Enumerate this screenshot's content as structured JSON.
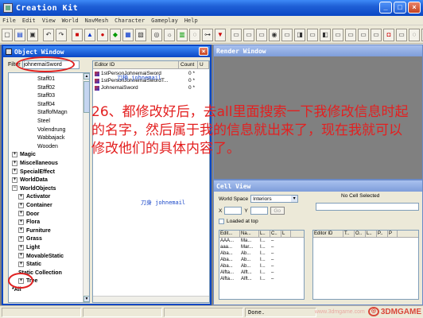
{
  "window": {
    "title": "Creation Kit"
  },
  "menu": [
    "File",
    "Edit",
    "View",
    "World",
    "NavMesh",
    "Character",
    "Gameplay",
    "Help"
  ],
  "object_window": {
    "title": "Object Window",
    "filter_label": "Filter",
    "filter_value": "johnemaiSword",
    "tree_items": [
      {
        "label": "Staff01",
        "level": 3,
        "bold": false
      },
      {
        "label": "Staff02",
        "level": 3,
        "bold": false
      },
      {
        "label": "Staff03",
        "level": 3,
        "bold": false
      },
      {
        "label": "Staff04",
        "level": 3,
        "bold": false
      },
      {
        "label": "StaffofMagn",
        "level": 3,
        "bold": false
      },
      {
        "label": "Steel",
        "level": 3,
        "bold": false
      },
      {
        "label": "Volendrung",
        "level": 3,
        "bold": false
      },
      {
        "label": "Wabbajack",
        "level": 3,
        "bold": false
      },
      {
        "label": "Wooden",
        "level": 3,
        "bold": false
      },
      {
        "label": "Magic",
        "level": 0,
        "bold": true,
        "exp": "+"
      },
      {
        "label": "Miscellaneous",
        "level": 0,
        "bold": true,
        "exp": "+"
      },
      {
        "label": "SpecialEffect",
        "level": 0,
        "bold": true,
        "exp": "+"
      },
      {
        "label": "WorldData",
        "level": 0,
        "bold": true,
        "exp": "+"
      },
      {
        "label": "WorldObjects",
        "level": 0,
        "bold": true,
        "exp": "−"
      },
      {
        "label": "Activator",
        "level": 1,
        "bold": true,
        "exp": "+"
      },
      {
        "label": "Container",
        "level": 1,
        "bold": true,
        "exp": "+"
      },
      {
        "label": "Door",
        "level": 1,
        "bold": true,
        "exp": "+"
      },
      {
        "label": "Flora",
        "level": 1,
        "bold": true,
        "exp": "+"
      },
      {
        "label": "Furniture",
        "level": 1,
        "bold": true,
        "exp": "+"
      },
      {
        "label": "Grass",
        "level": 1,
        "bold": true,
        "exp": "+"
      },
      {
        "label": "Light",
        "level": 1,
        "bold": true,
        "exp": "+"
      },
      {
        "label": "MovableStatic",
        "level": 1,
        "bold": true,
        "exp": "+"
      },
      {
        "label": "Static",
        "level": 1,
        "bold": true,
        "exp": "+"
      },
      {
        "label": "Static Collection",
        "level": 1,
        "bold": true,
        "exp": ""
      },
      {
        "label": "Tree",
        "level": 1,
        "bold": true,
        "exp": "+"
      },
      {
        "label": "*All",
        "level": 0,
        "bold": true,
        "exp": ""
      }
    ],
    "list_columns": [
      "Editor ID",
      "Count",
      "U"
    ],
    "list_rows": [
      {
        "name": "1stPersonJohnemaiSword",
        "count": "0 *"
      },
      {
        "name": "1stPersonJohnemaiSwordT...",
        "count": "0 *"
      },
      {
        "name": "JohnemaiSword",
        "count": "0 *"
      }
    ],
    "overlay_texts": [
      "刀柄 johnemail",
      "刀身 johnemail"
    ]
  },
  "render_window": {
    "title": "Render Window"
  },
  "cell_view": {
    "title": "Cell View",
    "worldspace_label": "World Space",
    "worldspace_value": "Interiors",
    "x_label": "X",
    "y_label": "Y",
    "go_label": "Go",
    "loaded_label": "Loaded at top",
    "no_cell_label": "No Cell Selected",
    "left_columns": [
      "Edit...",
      "Na...",
      "L..",
      "C..",
      "L"
    ],
    "left_rows": [
      [
        "AAA...",
        "Ma...",
        "I...",
        "–",
        ""
      ],
      [
        "aaa...",
        "Mar...",
        "I...",
        "–",
        ""
      ],
      [
        "Aba...",
        "Ab...",
        "I...",
        "–",
        ""
      ],
      [
        "Aba...",
        "Ab...",
        "I...",
        "–",
        ""
      ],
      [
        "Aba...",
        "Ab...",
        "I...",
        "–",
        ""
      ],
      [
        "Alfta...",
        "Alft...",
        "I...",
        "–",
        ""
      ],
      [
        "Alfta...",
        "Alft...",
        "I...",
        "–",
        ""
      ]
    ],
    "right_columns": [
      "Editor ID",
      "T..",
      "O..",
      "L..",
      "P..",
      "P"
    ]
  },
  "status": {
    "text": "Done."
  },
  "watermark": {
    "brand": "3DMGAME",
    "sub": "www.3dmgame.com"
  },
  "annotation": "26、都修改好后，去all里面搜索一下我修改信息时起的名字，然后属于我的信息就出来了，现在我就可以修改他们的具体内容了。"
}
